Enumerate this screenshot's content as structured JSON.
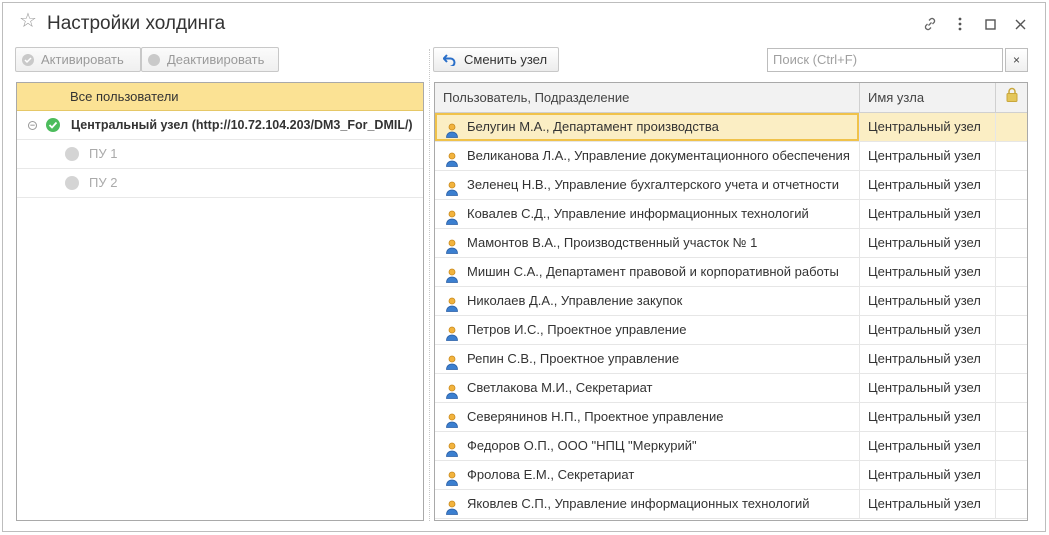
{
  "window": {
    "title": "Настройки холдинга"
  },
  "toolbar_left": {
    "activate_label": "Активировать",
    "deactivate_label": "Деактивировать"
  },
  "toolbar_right": {
    "change_node_label": "Сменить узел",
    "search_placeholder": "Поиск (Ctrl+F)",
    "search_clear": "×"
  },
  "tree": {
    "header": "Все пользователи",
    "root_label": "Центральный узел (http://10.72.104.203/DM3_For_DMIL/)",
    "children": [
      "ПУ 1",
      "ПУ 2"
    ]
  },
  "table": {
    "columns": {
      "user": "Пользователь, Подразделение",
      "node": "Имя узла"
    },
    "rows": [
      {
        "user": "Белугин М.А., Департамент производства",
        "node": "Центральный узел"
      },
      {
        "user": "Великанова Л.А., Управление документационного обеспечения",
        "node": "Центральный узел"
      },
      {
        "user": "Зеленец Н.В., Управление бухгалтерского учета и отчетности",
        "node": "Центральный узел"
      },
      {
        "user": "Ковалев С.Д., Управление информационных технологий",
        "node": "Центральный узел"
      },
      {
        "user": "Мамонтов В.А., Производственный участок № 1",
        "node": "Центральный узел"
      },
      {
        "user": "Мишин С.А., Департамент правовой и корпоративной работы",
        "node": "Центральный узел"
      },
      {
        "user": "Николаев Д.А., Управление закупок",
        "node": "Центральный узел"
      },
      {
        "user": "Петров И.С., Проектное управление",
        "node": "Центральный узел"
      },
      {
        "user": "Репин С.В., Проектное управление",
        "node": "Центральный узел"
      },
      {
        "user": "Светлакова М.И., Секретариат",
        "node": "Центральный узел"
      },
      {
        "user": "Северянинов Н.П., Проектное управление",
        "node": "Центральный узел"
      },
      {
        "user": "Федоров О.П., ООО \"НПЦ \"Меркурий\"",
        "node": "Центральный узел"
      },
      {
        "user": "Фролова Е.М., Секретариат",
        "node": "Центральный узел"
      },
      {
        "user": "Яковлев С.П., Управление информационных технологий",
        "node": "Центральный узел"
      }
    ]
  },
  "colors": {
    "tree_header": "#fbe294",
    "selected_row": "#fbeec4",
    "active_status": "#4cbc5c",
    "accent_blue": "#2a6fc9"
  },
  "icons": {
    "favorite": "star-icon",
    "link": "link-icon",
    "more": "more-icon",
    "maximize": "maximize-icon",
    "close": "close-icon",
    "change_node": "undo-arrow-icon",
    "lock": "lock-icon",
    "user": "user-icon"
  }
}
